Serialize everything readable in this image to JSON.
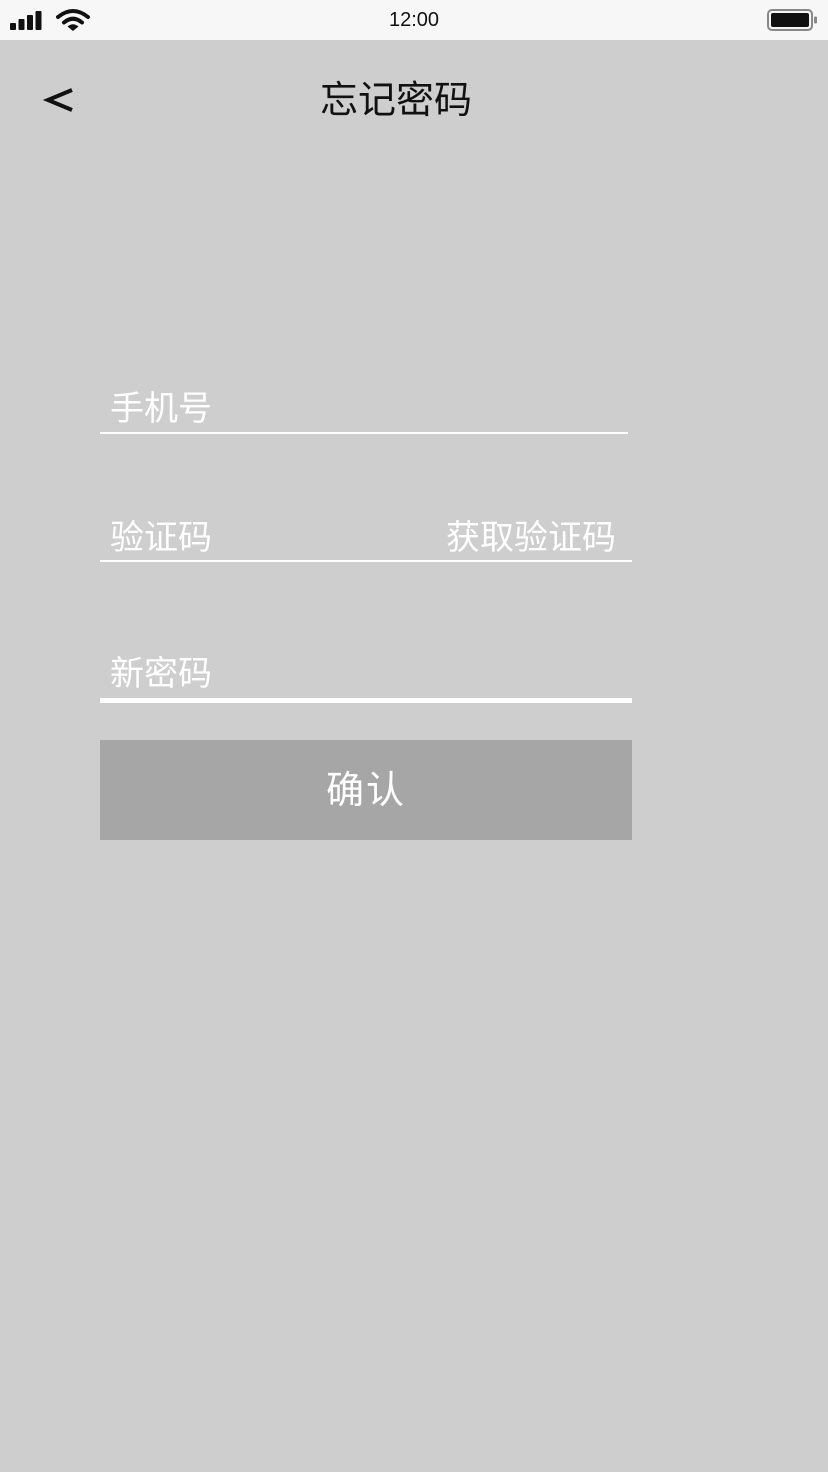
{
  "status_bar": {
    "time": "12:00",
    "icons": [
      "signal-icon",
      "wifi-icon",
      "battery-icon"
    ]
  },
  "header": {
    "back_label": "<",
    "title": "忘记密码"
  },
  "form": {
    "phone_placeholder": "手机号",
    "code_placeholder": "验证码",
    "get_code_label": "获取验证码",
    "new_password_placeholder": "新密码",
    "confirm_label": "确认"
  },
  "colors": {
    "background": "#cecece",
    "status_bar": "#f7f7f7",
    "button": "#a6a6a6",
    "text_light": "#ffffff",
    "text_dark": "#111111"
  }
}
